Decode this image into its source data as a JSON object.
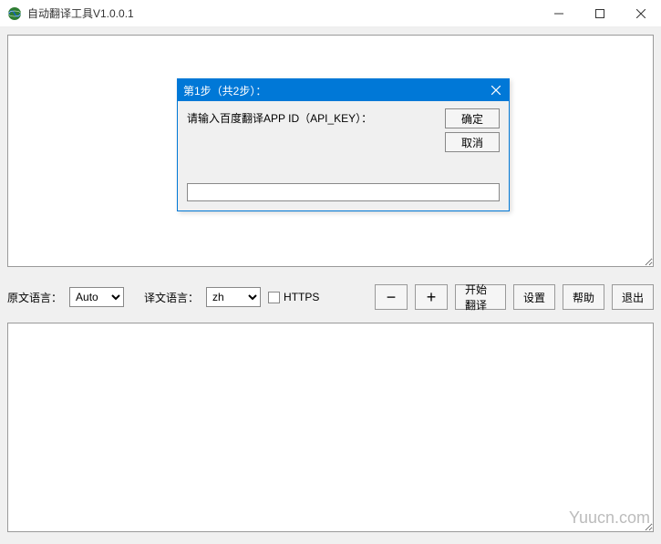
{
  "window": {
    "title": "自动翻译工具V1.0.0.1"
  },
  "toolbar": {
    "src_label": "原文语言：",
    "src_value": "Auto",
    "tgt_label": "译文语言：",
    "tgt_value": "zh",
    "https_label": "HTTPS",
    "minus": "−",
    "plus": "+",
    "start": "开始翻译",
    "settings": "设置",
    "help": "帮助",
    "exit": "退出"
  },
  "dialog": {
    "title": "第1步（共2步）：",
    "prompt": "请输入百度翻译APP ID（API_KEY）：",
    "ok": "确定",
    "cancel": "取消",
    "input_value": ""
  },
  "watermark": "Yuucn.com"
}
